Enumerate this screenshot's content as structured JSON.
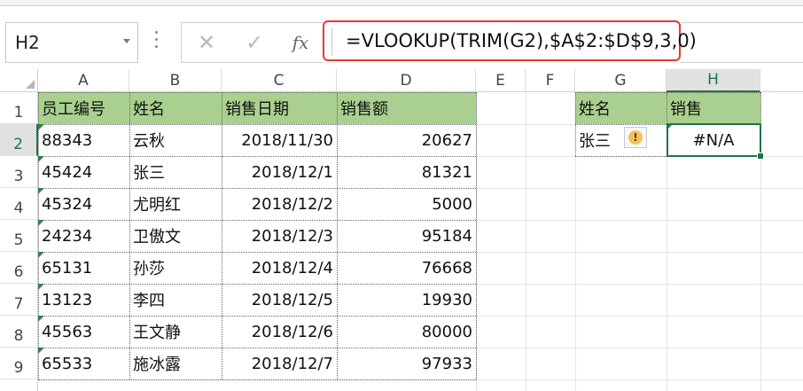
{
  "name_box": {
    "value": "H2"
  },
  "formula_bar": {
    "cancel_icon": "close-icon",
    "enter_icon": "check-icon",
    "fx_label": "fx",
    "formula": "=VLOOKUP(TRIM(G2),$A$2:$D$9,3,0)"
  },
  "columns": [
    "A",
    "B",
    "C",
    "D",
    "E",
    "F",
    "G",
    "H"
  ],
  "rows": [
    "1",
    "2",
    "3",
    "4",
    "5",
    "6",
    "7",
    "8",
    "9"
  ],
  "table": {
    "headers": [
      "员工编号",
      "姓名",
      "销售日期",
      "销售额"
    ],
    "rows": [
      [
        "88343",
        "云秋",
        "2018/11/30",
        "20627"
      ],
      [
        "45424",
        "张三",
        "2018/12/1",
        "81321"
      ],
      [
        "45324",
        "尤明红",
        "2018/12/2",
        "5000"
      ],
      [
        "24234",
        "卫傲文",
        "2018/12/3",
        "95184"
      ],
      [
        "65131",
        "孙莎",
        "2018/12/4",
        "76668"
      ],
      [
        "13123",
        "李四",
        "2018/12/5",
        "19930"
      ],
      [
        "45563",
        "王文静",
        "2018/12/6",
        "80000"
      ],
      [
        "65533",
        "施冰露",
        "2018/12/7",
        "97933"
      ]
    ]
  },
  "lookup": {
    "header_name": "姓名",
    "header_sales": "销售",
    "name_value": "张三",
    "result": "#N/A",
    "warning_icon": "warning-icon"
  },
  "colors": {
    "header_fill": "#a9d08e",
    "selection": "#217346",
    "formula_highlight": "#e53935"
  }
}
